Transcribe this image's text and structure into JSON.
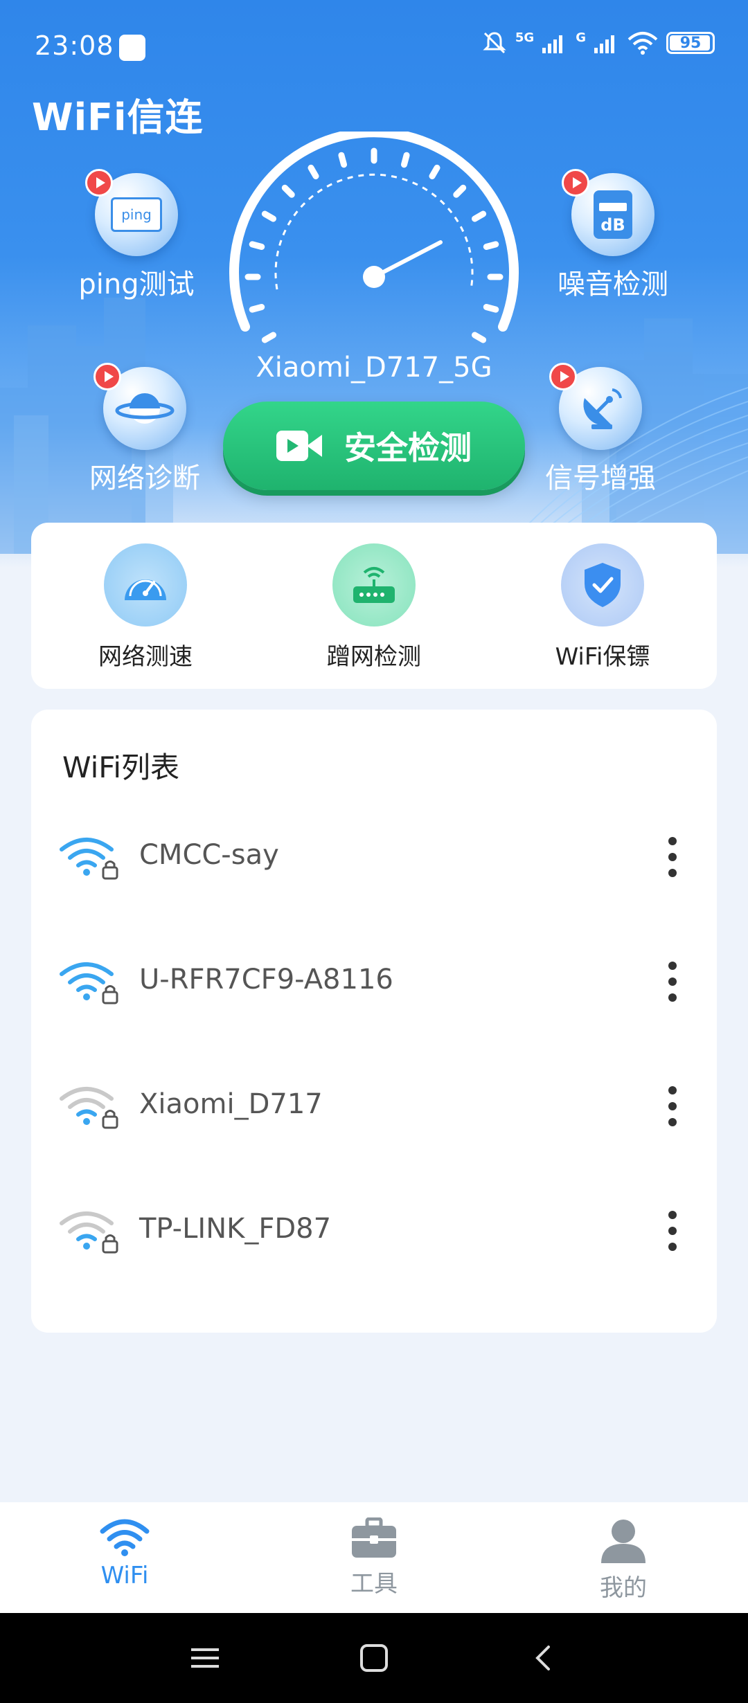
{
  "status_bar": {
    "time": "23:08",
    "battery": "95",
    "network_label_1": "5G",
    "network_label_2": "G"
  },
  "app": {
    "title": "WiFi信连"
  },
  "hero": {
    "connected_ssid": "Xiaomi_D717_5G",
    "scan_button_label": "安全检测",
    "features": [
      {
        "label": "ping测试",
        "icon": "ping-icon",
        "badge_text": "ping"
      },
      {
        "label": "噪音检测",
        "icon": "decibel-meter-icon",
        "badge_text": "dB"
      },
      {
        "label": "网络诊断",
        "icon": "planet-icon"
      },
      {
        "label": "信号增强",
        "icon": "satellite-dish-icon"
      }
    ]
  },
  "quick_tools": [
    {
      "label": "网络测速",
      "icon": "speedometer-icon"
    },
    {
      "label": "蹭网检测",
      "icon": "router-icon"
    },
    {
      "label": "WiFi保镖",
      "icon": "shield-check-icon"
    }
  ],
  "wifi_list": {
    "title": "WiFi列表",
    "networks": [
      {
        "ssid": "CMCC-say",
        "signal": 3,
        "locked": true
      },
      {
        "ssid": "U-RFR7CF9-A8116",
        "signal": 3,
        "locked": true
      },
      {
        "ssid": "Xiaomi_D717",
        "signal": 1,
        "locked": true
      },
      {
        "ssid": "TP-LINK_FD87",
        "signal": 1,
        "locked": true
      }
    ]
  },
  "tabbar": {
    "tabs": [
      {
        "label": "WiFi",
        "icon": "wifi-icon",
        "active": true
      },
      {
        "label": "工具",
        "icon": "toolbox-icon",
        "active": false
      },
      {
        "label": "我的",
        "icon": "person-icon",
        "active": false
      }
    ]
  },
  "colors": {
    "primary": "#2f86ea",
    "accent_green": "#1fb36e",
    "tab_active": "#2f8ff0",
    "tab_inactive": "#9aa3ad",
    "wifi_signal_strong": "#3aa6f0",
    "wifi_signal_weak": "#c9c9c9"
  }
}
